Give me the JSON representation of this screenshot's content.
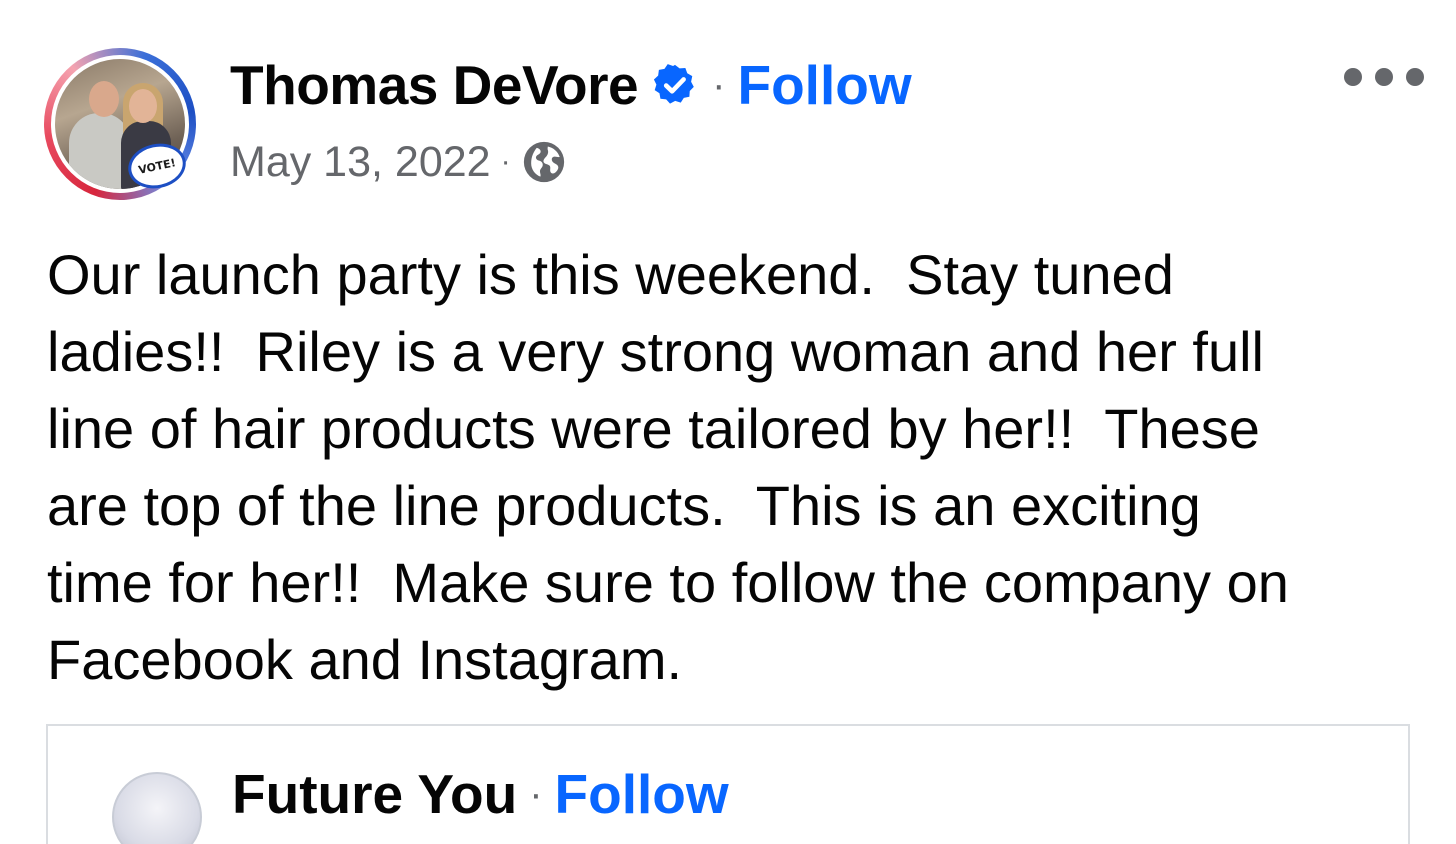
{
  "post": {
    "author": {
      "name": "Thomas DeVore",
      "verified": true,
      "avatar_badge": "VOTE!",
      "follow_label": "Follow",
      "separator": "·"
    },
    "meta": {
      "date": "May 13, 2022",
      "separator": "·",
      "audience_icon": "globe-icon"
    },
    "more_icon": "more-options-icon",
    "text": "Our launch party is this weekend.  Stay tuned\nladies!!  Riley is a very strong woman and her full\nline of hair products were tailored by her!!  These\nare top of the line products.  This is an exciting\ntime for her!!  Make sure to follow the company on\nFacebook and Instagram."
  },
  "shared_post": {
    "author": {
      "name": "Future You",
      "separator": "·",
      "follow_label": "Follow"
    }
  },
  "colors": {
    "text_primary": "#050505",
    "text_secondary": "#65676b",
    "link_blue": "#0866ff",
    "verified_blue": "#0866ff",
    "card_border": "#dadde1"
  }
}
